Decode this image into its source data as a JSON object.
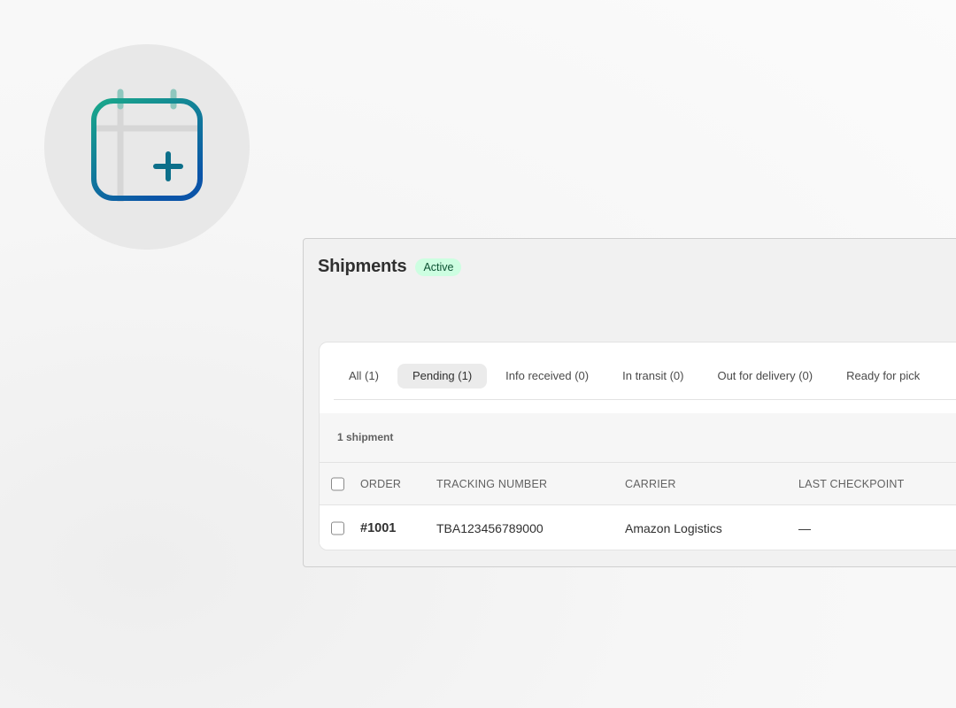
{
  "badge": {
    "icon": "calendar-plus-icon",
    "colors": {
      "gradient_start": "#1aa88a",
      "gradient_end": "#0a54a8",
      "plus": "#0c6f8a"
    }
  },
  "panel": {
    "title": "Shipments",
    "status": "Active",
    "status_color": "#cdfee1"
  },
  "tabs": [
    {
      "label": "All (1)",
      "active": false
    },
    {
      "label": "Pending (1)",
      "active": true
    },
    {
      "label": "Info received (0)",
      "active": false
    },
    {
      "label": "In transit (0)",
      "active": false
    },
    {
      "label": "Out for delivery (0)",
      "active": false
    },
    {
      "label": "Ready for pick",
      "active": false
    }
  ],
  "summary": {
    "count_label": "1 shipment"
  },
  "table": {
    "columns": [
      "ORDER",
      "TRACKING NUMBER",
      "CARRIER",
      "LAST CHECKPOINT"
    ],
    "rows": [
      {
        "order": "#1001",
        "tracking": "TBA123456789000",
        "carrier": "Amazon Logistics",
        "checkpoint": "—"
      }
    ]
  }
}
